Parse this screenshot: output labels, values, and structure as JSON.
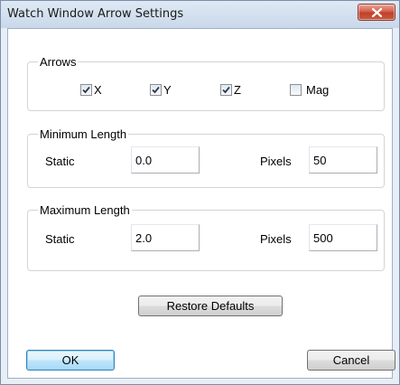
{
  "window": {
    "title": "Watch Window Arrow Settings"
  },
  "arrows": {
    "label": "Arrows",
    "options": [
      {
        "label": "X",
        "checked": true
      },
      {
        "label": "Y",
        "checked": true
      },
      {
        "label": "Z",
        "checked": true
      },
      {
        "label": "Mag",
        "checked": false
      }
    ]
  },
  "minimum_length": {
    "label": "Minimum Length",
    "static_label": "Static",
    "static_value": "0.0",
    "pixels_label": "Pixels",
    "pixels_value": "50"
  },
  "maximum_length": {
    "label": "Maximum Length",
    "static_label": "Static",
    "static_value": "2.0",
    "pixels_label": "Pixels",
    "pixels_value": "500"
  },
  "buttons": {
    "restore_defaults": "Restore Defaults",
    "ok": "OK",
    "cancel": "Cancel"
  },
  "colors": {
    "title_bar": "#c9d8ea",
    "close_button": "#c0402b",
    "check_mark": "#2b3a4f"
  },
  "icons": {
    "close": "close-x-icon",
    "check": "check-mark-icon"
  }
}
